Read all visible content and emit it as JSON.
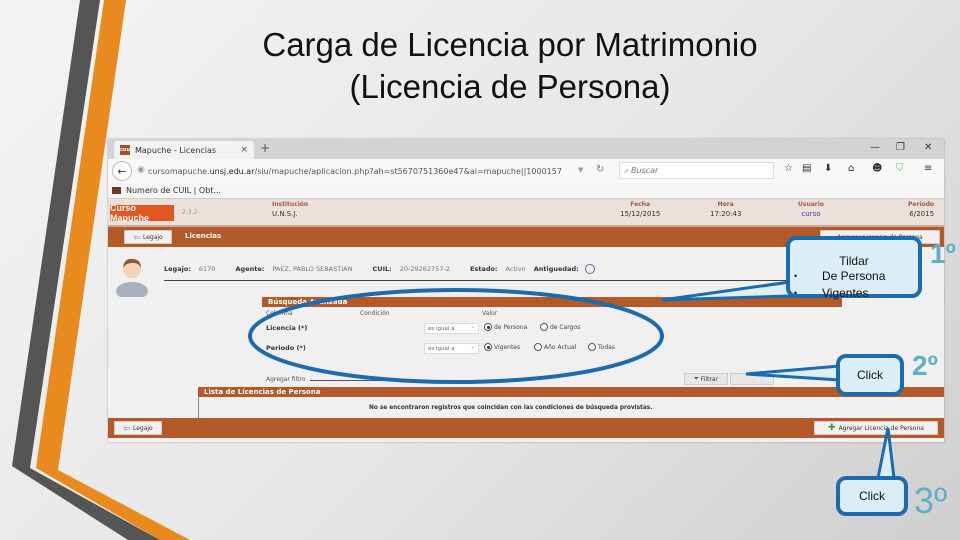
{
  "slide": {
    "title_line1": "Carga de Licencia por Matrimonio",
    "title_line2": "(Licencia de Persona)"
  },
  "browser": {
    "tab_favicon": "cuu",
    "tab_title": "Mapuche - Licencias",
    "tab_close": "×",
    "new_tab": "+",
    "window_controls": [
      "—",
      "❐",
      "✕"
    ],
    "url_prefix": "cursomapuche.",
    "url_domain": "unsj.edu.ar",
    "url_rest": "/siu/mapuche/aplicacion.php?ah=st5670751360e47&ai=mapuche||1000157",
    "search_placeholder": "Buscar",
    "bookmark": "Numero de CUIL | Obt..."
  },
  "app": {
    "logo": "Curso Mapuche",
    "version": "2.3.2",
    "header": {
      "institucion": {
        "label": "Institución",
        "value": "U.N.S.J."
      },
      "fecha": {
        "label": "Fecha",
        "value": "15/12/2015"
      },
      "hora": {
        "label": "Hora",
        "value": "17:20:43"
      },
      "usuario": {
        "label": "Usuario",
        "value": "curso"
      },
      "periodo": {
        "label": "Periodo",
        "value": "6/2015"
      }
    },
    "legajo_button": "Legajo",
    "page_title": "Licencias",
    "agregar_top_button": "Agregar Licencia de Persona",
    "agent": {
      "legajo_label": "Legajo:",
      "legajo_value": "6170",
      "agente_label": "Agente:",
      "agente_value": "PAEZ, PABLO SEBASTIAN",
      "cuil_label": "CUIL:",
      "cuil_value": "20-29262757-2",
      "estado_label": "Estado:",
      "estado_value": "Activo",
      "antiguedad_label": "Antiguedad:"
    },
    "advanced_search": {
      "title": "Búsqueda Avanzada",
      "columns": [
        "Columna",
        "Condición",
        "Valor"
      ],
      "rows": [
        {
          "label": "Licencia (*)",
          "condition": "es igual a",
          "options": [
            {
              "label": "de Persona",
              "selected": true
            },
            {
              "label": "de Cargos",
              "selected": false
            }
          ]
        },
        {
          "label": "Periodo (*)",
          "condition": "es igual a",
          "options": [
            {
              "label": "Vigentes",
              "selected": true
            },
            {
              "label": "Año Actual",
              "selected": false
            },
            {
              "label": "Todas",
              "selected": false
            }
          ]
        }
      ],
      "add_filter_label": "Agregar filtro",
      "filter_button": "Filtrar"
    },
    "list": {
      "title": "Lista de Licencias de Persona",
      "empty_message": "No se encontraron registros que coincidan con las condiciones de búsqueda provistas."
    },
    "footer": {
      "legajo_button": "Legajo",
      "agregar_button": "Agregar Licencia de Persona"
    }
  },
  "callouts": {
    "first": {
      "title": "Tildar",
      "items": [
        "De Persona",
        "Vigentes"
      ],
      "step": "1º"
    },
    "second": {
      "text": "Click",
      "step": "2º"
    },
    "third": {
      "text": "Click",
      "step": "3º"
    }
  },
  "colors": {
    "brand_brown": "#b35a28",
    "logo_orange": "#e2571f",
    "callout_border": "#1a6bb0",
    "callout_fill": "#dceef8",
    "step_number": "#5fb0c4"
  }
}
